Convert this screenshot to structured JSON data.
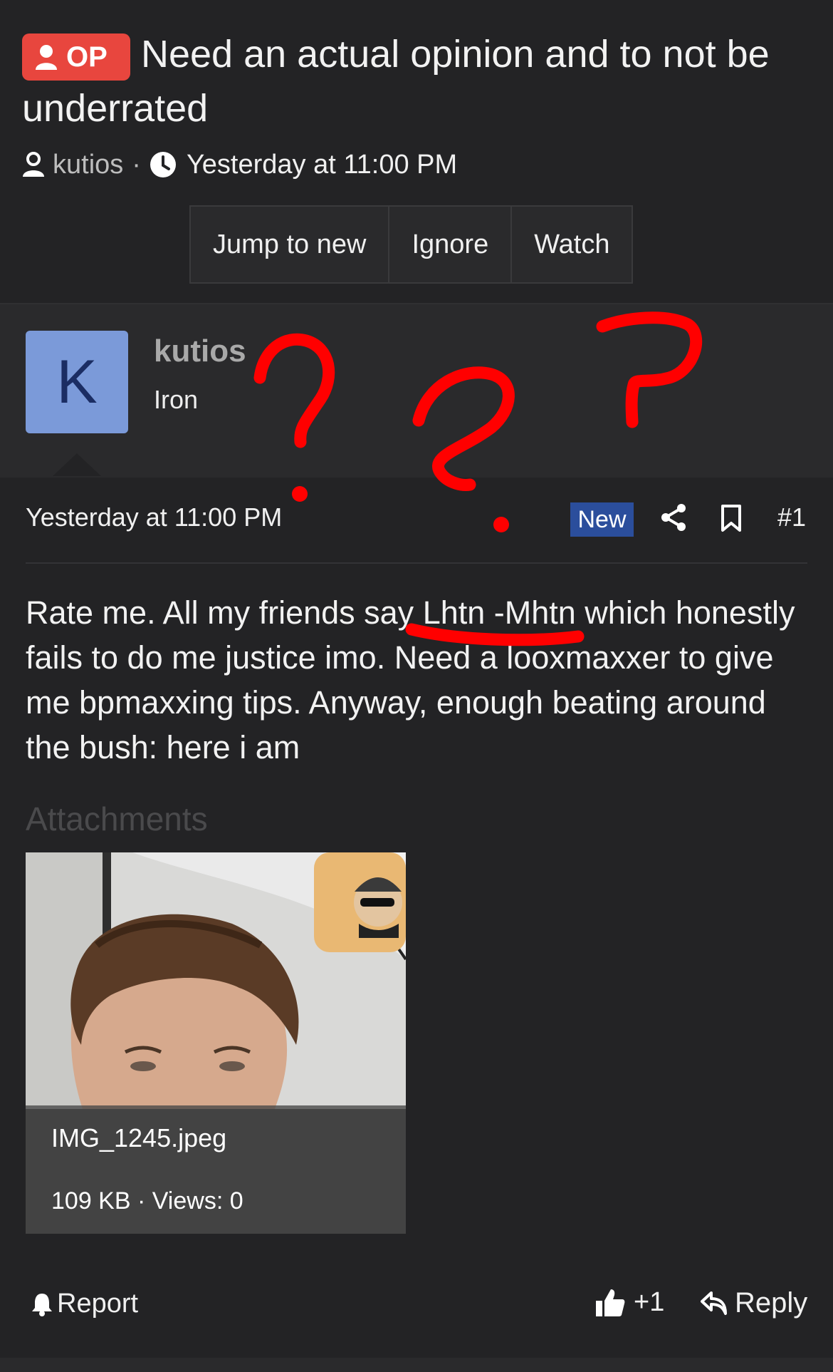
{
  "thread": {
    "op_badge": "OP",
    "title": "Need an actual opinion and to not be underrated",
    "author": "kutios",
    "time": "Yesterday at 11:00 PM"
  },
  "actions": {
    "jump_to_new": "Jump to new",
    "ignore": "Ignore",
    "watch": "Watch"
  },
  "user": {
    "avatar_letter": "K",
    "name": "kutios",
    "rank": "Iron"
  },
  "post": {
    "date": "Yesterday at 11:00 PM",
    "new_badge": "New",
    "number": "#1",
    "text": "Rate me. All my friends say Lhtn -Mhtn which honestly fails to do me justice imo. Need a looxmaxxer to give me bpmaxxing tips. Anyway, enough beating around the bush: here i am",
    "attachments_label": "Attachments",
    "attachment": {
      "filename": "IMG_1245.jpeg",
      "info": "109 KB · Views: 0"
    }
  },
  "footer": {
    "report": "Report",
    "like": "+1",
    "reply": "Reply"
  },
  "colors": {
    "background": "#232325",
    "op_badge": "#e8463e",
    "new_badge": "#2b4e9c",
    "avatar": "#7b9ad9",
    "annotation": "#ff0000"
  }
}
